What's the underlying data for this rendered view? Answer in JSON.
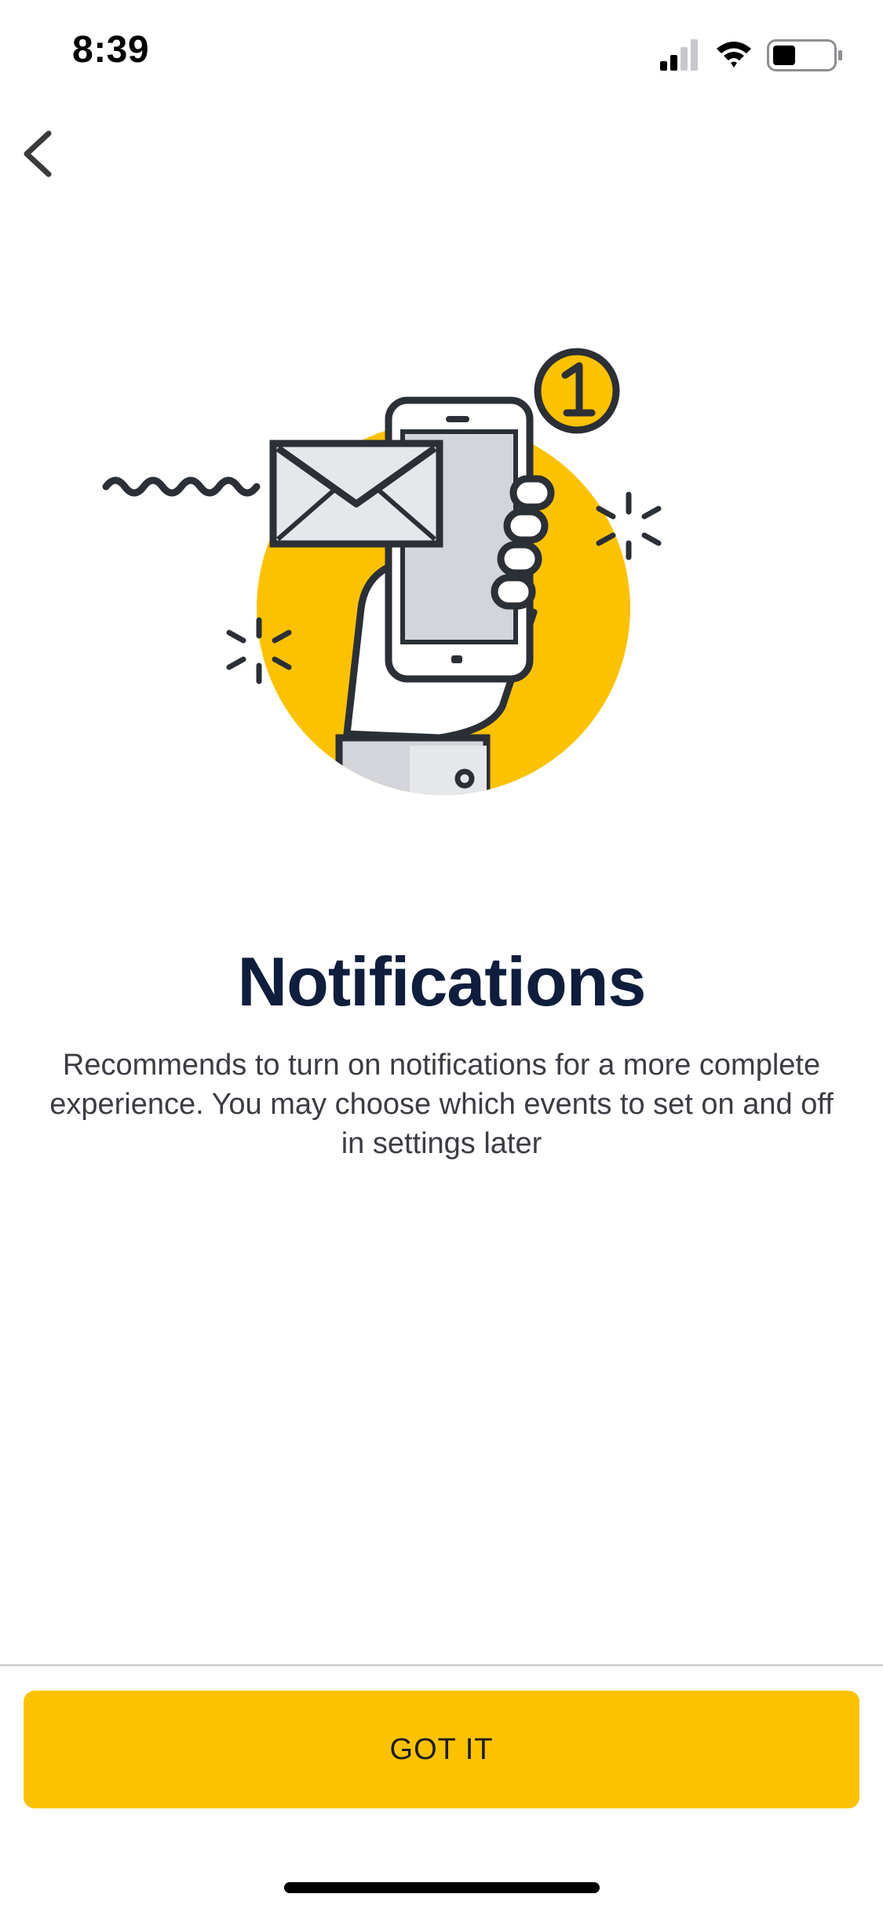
{
  "status_bar": {
    "time": "8:39",
    "icons": [
      "cellular-signal-icon",
      "wifi-icon",
      "battery-icon"
    ]
  },
  "nav": {
    "back_icon": "chevron-left-icon"
  },
  "illustration": {
    "icon": "phone-notification-illustration",
    "badge_count": "1",
    "accent_color": "#fcc202"
  },
  "content": {
    "title": "Notifications",
    "description": "Recommends to turn on notifications for a more complete experience. You may choose which events to set on and off in settings later"
  },
  "footer": {
    "button_label": "GOT IT",
    "button_color": "#fcc202"
  },
  "colors": {
    "title": "#0f1e3d",
    "text": "#3c3c43",
    "accent": "#fcc202"
  }
}
